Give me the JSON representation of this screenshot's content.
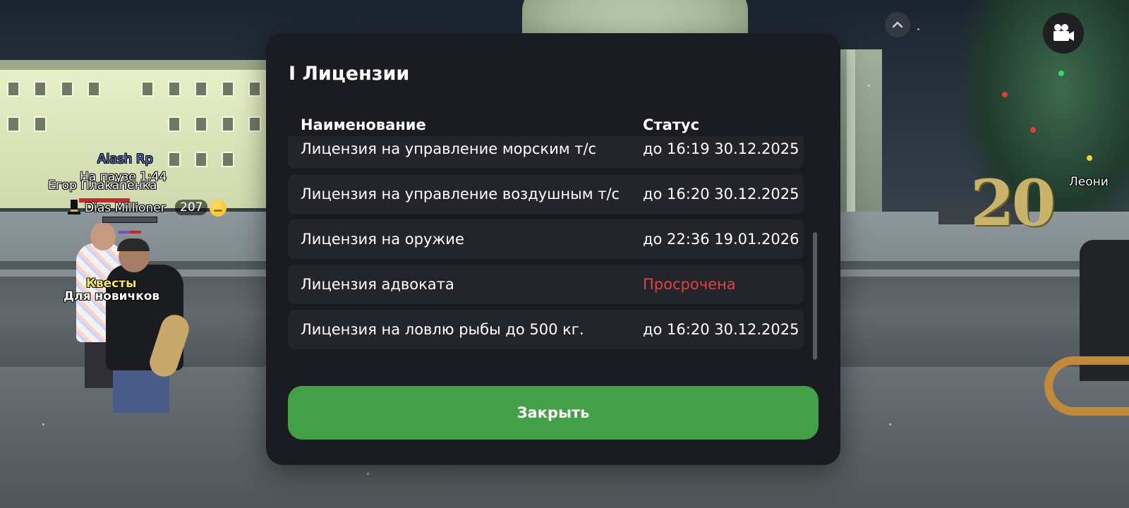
{
  "game_hud": {
    "server_name": "Alash Rp",
    "pause_text": "На паузе 1:44",
    "nearby_player_name": "Егор Плакапенка",
    "player_name": "Dias Millioner",
    "player_level": "207",
    "npc_label_line1": "Квесты",
    "npc_label_line2": "Для новичков",
    "partial_name_right": "Леони",
    "sign_text": "20"
  },
  "modal": {
    "title": "I Лицензии",
    "columns": {
      "name": "Наименование",
      "status": "Статус"
    },
    "licenses": [
      {
        "name": "Лицензия на управление морским т/с",
        "status": "до 16:19 30.12.2025",
        "expired": false
      },
      {
        "name": "Лицензия на управление воздушным т/с",
        "status": "до 16:20 30.12.2025",
        "expired": false
      },
      {
        "name": "Лицензия на оружие",
        "status": "до 22:36 19.01.2026",
        "expired": false
      },
      {
        "name": "Лицензия адвоката",
        "status": "Просрочена",
        "expired": true
      },
      {
        "name": "Лицензия на ловлю рыбы до 500 кг.",
        "status": "до 16:20 30.12.2025",
        "expired": false
      }
    ],
    "close_label": "Закрыть"
  },
  "colors": {
    "modal_bg": "#1b1c21",
    "row_bg": "#24252b",
    "accent_green": "#43a047",
    "expired_red": "#e0433f"
  },
  "icons": [
    "chevron-up-icon",
    "video-camera-icon"
  ]
}
